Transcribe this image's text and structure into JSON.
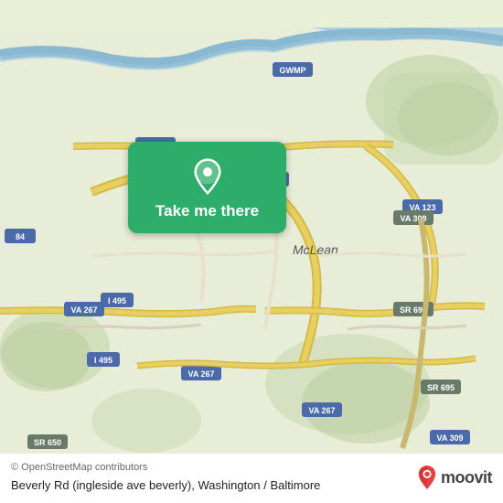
{
  "map": {
    "background_color": "#e8edd8",
    "attribution": "© OpenStreetMap contributors",
    "location_name": "Beverly Rd (ingleside ave beverly), Washington / Baltimore"
  },
  "overlay": {
    "button_label": "Take me there",
    "button_bg": "#2eac6a"
  },
  "branding": {
    "moovit_text": "moovit",
    "pin_color_top": "#e84040",
    "pin_color_bottom": "#c02020"
  }
}
